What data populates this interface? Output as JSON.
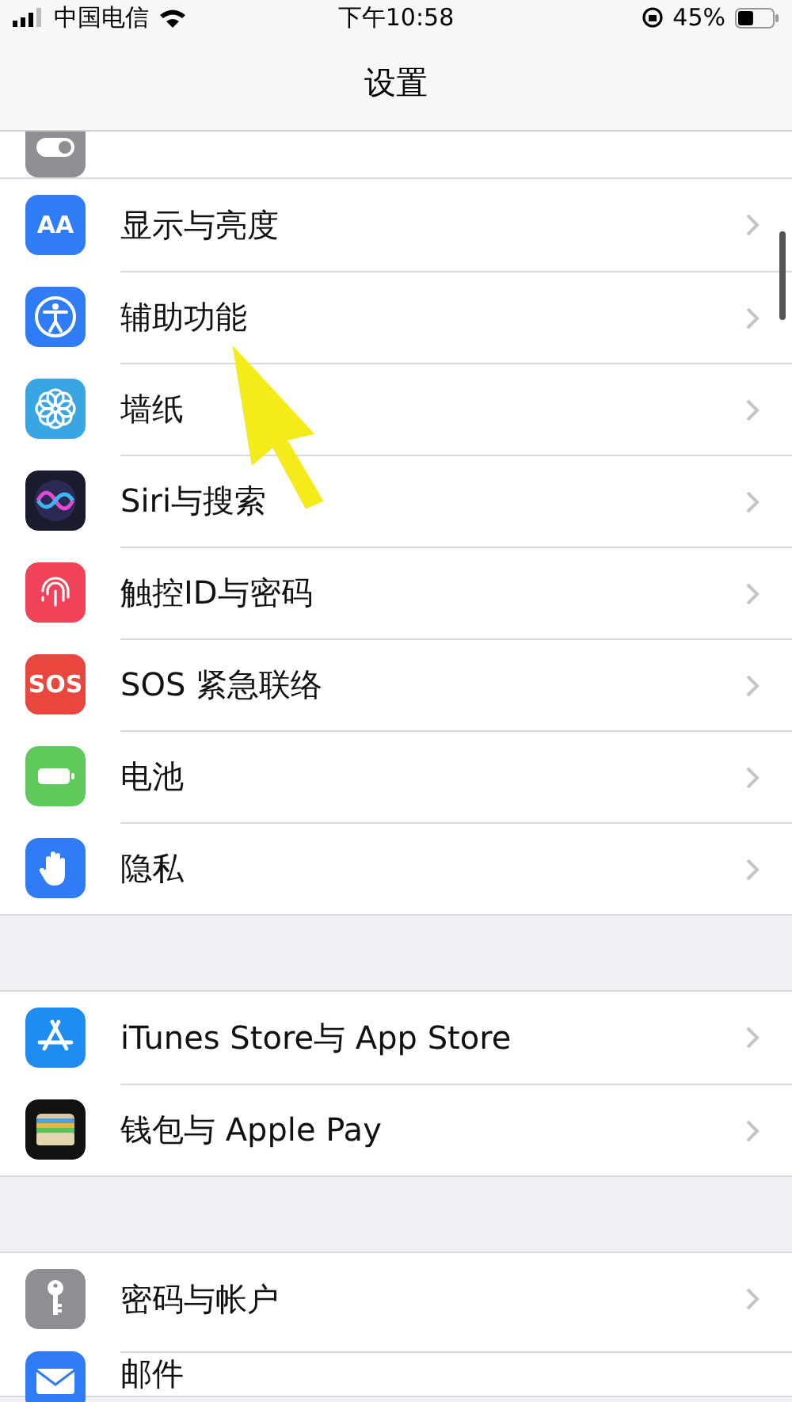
{
  "status_bar": {
    "carrier": "中国电信",
    "time": "下午10:58",
    "battery": "45%",
    "level": 0.45
  },
  "nav": {
    "title": "设置"
  },
  "groups": [
    {
      "rows": [
        {
          "label": "显示与亮度",
          "icon_text": "AA"
        },
        {
          "label": "辅助功能"
        },
        {
          "label": "墙纸"
        },
        {
          "label": "Siri与搜索"
        },
        {
          "label": "触控ID与密码"
        },
        {
          "label": "SOS 紧急联络",
          "icon_text": "SOS"
        },
        {
          "label": "电池"
        },
        {
          "label": "隐私"
        }
      ]
    },
    {
      "rows": [
        {
          "label": "iTunes Store与 App Store"
        },
        {
          "label": "钱包与 Apple Pay"
        }
      ]
    },
    {
      "rows": [
        {
          "label": "密码与帐户"
        },
        {
          "label": "邮件"
        }
      ]
    }
  ]
}
